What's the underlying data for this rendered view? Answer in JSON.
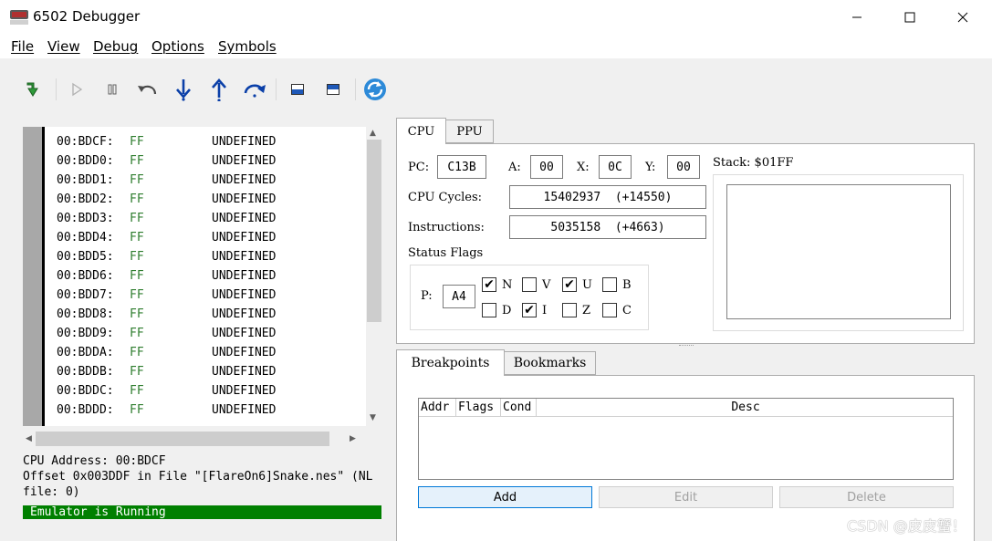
{
  "window": {
    "title": "6502 Debugger"
  },
  "menu": [
    "File",
    "View",
    "Debug",
    "Options",
    "Symbols"
  ],
  "disassembly": [
    {
      "addr": "00:BDCF:",
      "op": "FF",
      "mn": "UNDEFINED"
    },
    {
      "addr": "00:BDD0:",
      "op": "FF",
      "mn": "UNDEFINED"
    },
    {
      "addr": "00:BDD1:",
      "op": "FF",
      "mn": "UNDEFINED"
    },
    {
      "addr": "00:BDD2:",
      "op": "FF",
      "mn": "UNDEFINED"
    },
    {
      "addr": "00:BDD3:",
      "op": "FF",
      "mn": "UNDEFINED"
    },
    {
      "addr": "00:BDD4:",
      "op": "FF",
      "mn": "UNDEFINED"
    },
    {
      "addr": "00:BDD5:",
      "op": "FF",
      "mn": "UNDEFINED"
    },
    {
      "addr": "00:BDD6:",
      "op": "FF",
      "mn": "UNDEFINED"
    },
    {
      "addr": "00:BDD7:",
      "op": "FF",
      "mn": "UNDEFINED"
    },
    {
      "addr": "00:BDD8:",
      "op": "FF",
      "mn": "UNDEFINED"
    },
    {
      "addr": "00:BDD9:",
      "op": "FF",
      "mn": "UNDEFINED"
    },
    {
      "addr": "00:BDDA:",
      "op": "FF",
      "mn": "UNDEFINED"
    },
    {
      "addr": "00:BDDB:",
      "op": "FF",
      "mn": "UNDEFINED"
    },
    {
      "addr": "00:BDDC:",
      "op": "FF",
      "mn": "UNDEFINED"
    },
    {
      "addr": "00:BDDD:",
      "op": "FF",
      "mn": "UNDEFINED"
    }
  ],
  "info": {
    "cpu_address": "CPU Address: 00:BDCF",
    "offset": "Offset 0x003DDF in File \"[FlareOn6]Snake.nes\" (NL",
    "file": "file: 0)",
    "status": "Emulator is Running"
  },
  "cpu_tabs": {
    "cpu": "CPU",
    "ppu": "PPU"
  },
  "registers": {
    "pc_label": "PC:",
    "pc": "C13B",
    "a_label": "A:",
    "a": "00",
    "x_label": "X:",
    "x": "0C",
    "y_label": "Y:",
    "y": "00",
    "cycles_label": "CPU Cycles:",
    "cycles": "15402937  (+14550)",
    "instr_label": "Instructions:",
    "instr": "5035158  (+4663)",
    "stack_label": "Stack: $01FF"
  },
  "status_flags": {
    "title": "Status Flags",
    "p_label": "P:",
    "p": "A4",
    "flags": [
      {
        "name": "N",
        "checked": true
      },
      {
        "name": "V",
        "checked": false
      },
      {
        "name": "U",
        "checked": true
      },
      {
        "name": "B",
        "checked": false
      },
      {
        "name": "D",
        "checked": false
      },
      {
        "name": "I",
        "checked": true
      },
      {
        "name": "Z",
        "checked": false
      },
      {
        "name": "C",
        "checked": false
      }
    ]
  },
  "bp_tabs": {
    "breakpoints": "Breakpoints",
    "bookmarks": "Bookmarks"
  },
  "bp_table": {
    "columns": [
      "Addr",
      "Flags",
      "Cond",
      "Desc"
    ]
  },
  "bp_buttons": {
    "add": "Add",
    "edit": "Edit",
    "delete": "Delete"
  },
  "watermark": "CSDN @皮皮蟹！",
  "colors": {
    "opcode": "#2e7d2e",
    "status_bg": "#008000",
    "accent": "#0078d7"
  }
}
